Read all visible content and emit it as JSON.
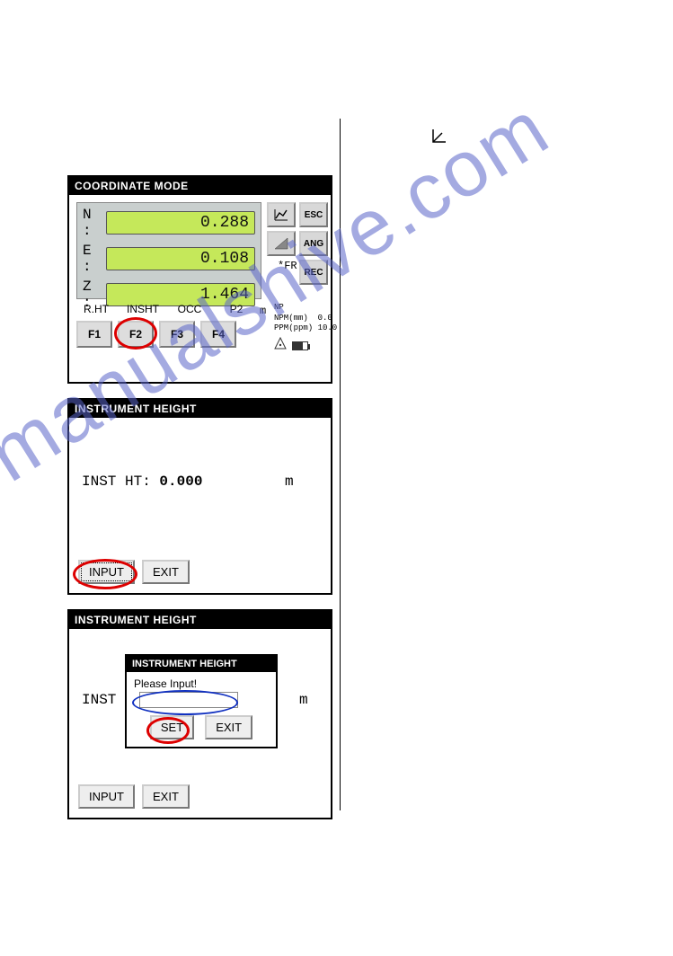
{
  "watermark": "manualshive.com",
  "panel1": {
    "title": "COORDINATE MODE",
    "rows": [
      {
        "label": "N :",
        "value": "0.288"
      },
      {
        "label": "E :",
        "value": "0.108"
      },
      {
        "label": "Z :",
        "value": "1.464"
      }
    ],
    "side_buttons": {
      "esc": "ESC",
      "ang": "ANG",
      "rec": "REC"
    },
    "fr_label": "*FR",
    "m_label": "m",
    "info": {
      "np": "NP",
      "npm": "NPM(mm)  0.0",
      "ppm": "PPM(ppm) 10.0"
    },
    "fkey_hints": [
      "R.HT",
      "INSHT",
      "OCC",
      "P2"
    ],
    "fkeys": [
      "F1",
      "F2",
      "F3",
      "F4"
    ]
  },
  "panel2": {
    "title": "INSTRUMENT HEIGHT",
    "label": "INST HT:",
    "value": "0.000",
    "unit": "m",
    "buttons": {
      "input": "INPUT",
      "exit": "EXIT"
    }
  },
  "panel3": {
    "title": "INSTRUMENT HEIGHT",
    "inst_label": "INST",
    "unit": "m",
    "buttons": {
      "input": "INPUT",
      "exit": "EXIT"
    },
    "dialog": {
      "title": "INSTRUMENT HEIGHT",
      "prompt": "Please Input!",
      "set": "SET",
      "exit": "EXIT"
    }
  }
}
